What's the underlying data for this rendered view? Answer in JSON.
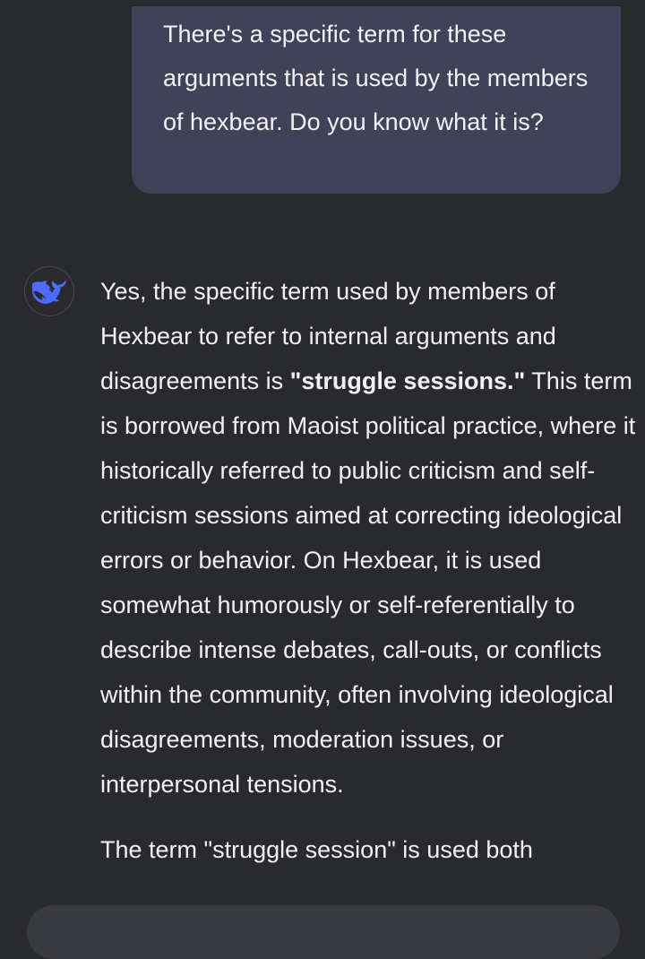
{
  "conversation": {
    "user_message": "There's a specific term for these arguments that is used by the members of hexbear. Do you know what it is?",
    "assistant": {
      "avatar_icon": "deepseek-whale-icon",
      "p1_a": "Yes, the specific term used by members of Hexbear to refer to internal arguments and disagreements is ",
      "p1_bold": "\"struggle sessions.\"",
      "p1_b": " This term is borrowed from Maoist political practice, where it historically referred to public criticism and self-criticism sessions aimed at correcting ideological errors or behavior. On Hexbear, it is used somewhat humorously or self-referentially to describe intense debates, call-outs, or conflicts within the community, often involving ideological disagreements, moderation issues, or interpersonal tensions.",
      "p2": "The term \"struggle session\" is used both"
    }
  },
  "colors": {
    "background": "#292a2d",
    "user_bubble": "#414158",
    "brand_accent": "#4d6bfe",
    "text": "#f1f1f3"
  }
}
